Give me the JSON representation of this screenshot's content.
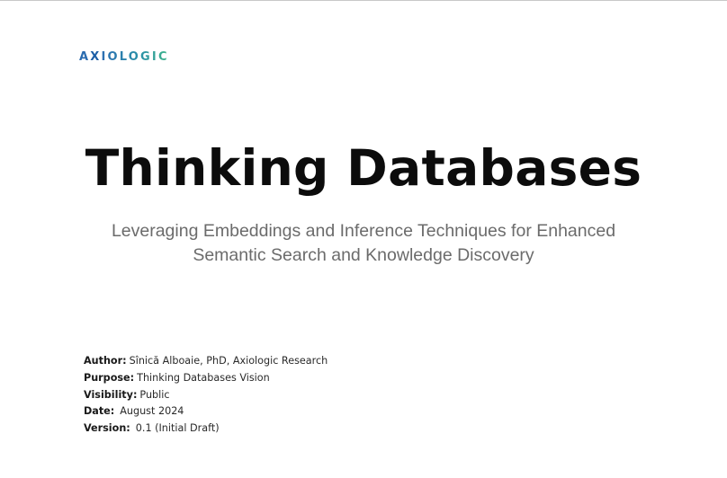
{
  "logo": {
    "text_a": "A",
    "text_x": "X",
    "text_rest": "IOLOGIC"
  },
  "title": "Thinking Databases",
  "subtitle_line1": "Leveraging Embeddings and Inference Techniques for Enhanced",
  "subtitle_line2": "Semantic Search and Knowledge Discovery",
  "meta": {
    "author_label": "Author:",
    "author_value": "Sînică Alboaie, PhD, Axiologic Research",
    "purpose_label": "Purpose:",
    "purpose_value": "Thinking Databases Vision",
    "visibility_label": "Visibility:",
    "visibility_value": "Public",
    "date_label": "Date:",
    "date_value": "August 2024",
    "version_label": "Version:",
    "version_value": "0.1 (Initial Draft)"
  },
  "colors": {
    "title": "#0c0c0c",
    "subtitle": "#6b6b6b",
    "logo_blue": "#2b6cb0",
    "logo_green": "#3fb58a"
  }
}
